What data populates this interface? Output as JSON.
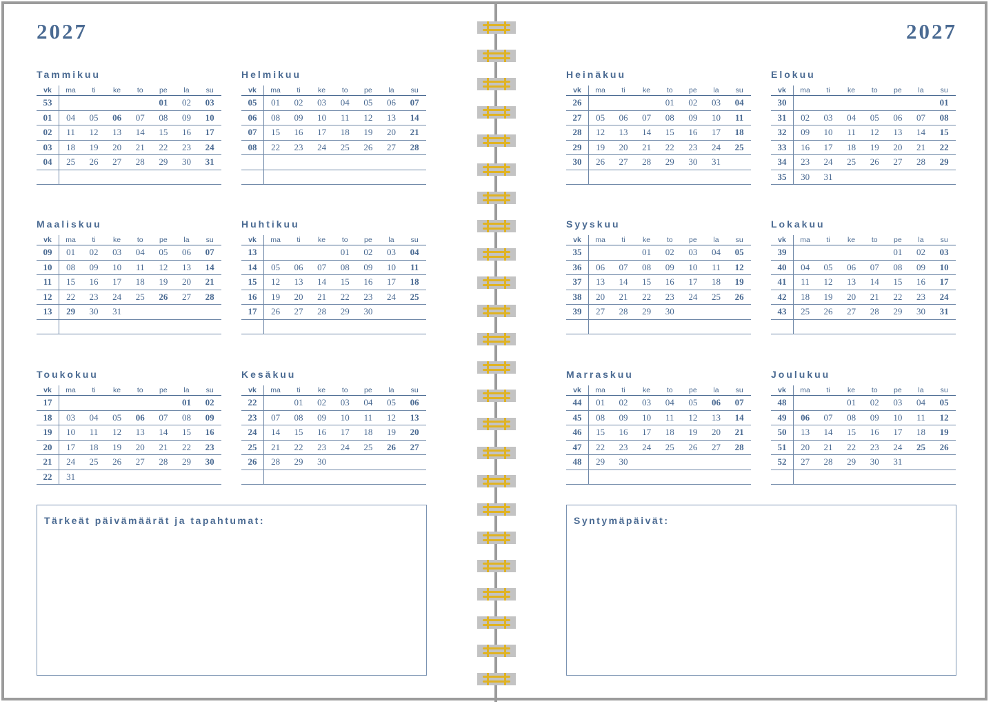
{
  "left_page": {
    "year": "2027"
  },
  "right_page": {
    "year": "2027"
  },
  "calendar": {
    "headers": [
      "vk",
      "ma",
      "ti",
      "ke",
      "to",
      "pe",
      "la",
      "su"
    ],
    "months": [
      {
        "name": "Tammikuu",
        "rows": [
          [
            "53",
            "",
            "",
            "",
            "",
            "01",
            "02",
            "03"
          ],
          [
            "01",
            "04",
            "05",
            "06",
            "07",
            "08",
            "09",
            "10"
          ],
          [
            "02",
            "11",
            "12",
            "13",
            "14",
            "15",
            "16",
            "17"
          ],
          [
            "03",
            "18",
            "19",
            "20",
            "21",
            "22",
            "23",
            "24"
          ],
          [
            "04",
            "25",
            "26",
            "27",
            "28",
            "29",
            "30",
            "31"
          ],
          [
            "",
            "",
            "",
            "",
            "",
            "",
            "",
            ""
          ]
        ],
        "holidays": [
          "01",
          "06"
        ]
      },
      {
        "name": "Helmikuu",
        "rows": [
          [
            "05",
            "01",
            "02",
            "03",
            "04",
            "05",
            "06",
            "07"
          ],
          [
            "06",
            "08",
            "09",
            "10",
            "11",
            "12",
            "13",
            "14"
          ],
          [
            "07",
            "15",
            "16",
            "17",
            "18",
            "19",
            "20",
            "21"
          ],
          [
            "08",
            "22",
            "23",
            "24",
            "25",
            "26",
            "27",
            "28"
          ],
          [
            "",
            "",
            "",
            "",
            "",
            "",
            "",
            ""
          ],
          [
            "",
            "",
            "",
            "",
            "",
            "",
            "",
            ""
          ]
        ],
        "holidays": []
      },
      {
        "name": "Maaliskuu",
        "rows": [
          [
            "09",
            "01",
            "02",
            "03",
            "04",
            "05",
            "06",
            "07"
          ],
          [
            "10",
            "08",
            "09",
            "10",
            "11",
            "12",
            "13",
            "14"
          ],
          [
            "11",
            "15",
            "16",
            "17",
            "18",
            "19",
            "20",
            "21"
          ],
          [
            "12",
            "22",
            "23",
            "24",
            "25",
            "26",
            "27",
            "28"
          ],
          [
            "13",
            "29",
            "30",
            "31",
            "",
            "",
            "",
            ""
          ],
          [
            "",
            "",
            "",
            "",
            "",
            "",
            "",
            ""
          ]
        ],
        "holidays": [
          "26",
          "29"
        ]
      },
      {
        "name": "Huhtikuu",
        "rows": [
          [
            "13",
            "",
            "",
            "",
            "01",
            "02",
            "03",
            "04"
          ],
          [
            "14",
            "05",
            "06",
            "07",
            "08",
            "09",
            "10",
            "11"
          ],
          [
            "15",
            "12",
            "13",
            "14",
            "15",
            "16",
            "17",
            "18"
          ],
          [
            "16",
            "19",
            "20",
            "21",
            "22",
            "23",
            "24",
            "25"
          ],
          [
            "17",
            "26",
            "27",
            "28",
            "29",
            "30",
            "",
            ""
          ],
          [
            "",
            "",
            "",
            "",
            "",
            "",
            "",
            ""
          ]
        ],
        "holidays": []
      },
      {
        "name": "Toukokuu",
        "rows": [
          [
            "17",
            "",
            "",
            "",
            "",
            "",
            "01",
            "02"
          ],
          [
            "18",
            "03",
            "04",
            "05",
            "06",
            "07",
            "08",
            "09"
          ],
          [
            "19",
            "10",
            "11",
            "12",
            "13",
            "14",
            "15",
            "16"
          ],
          [
            "20",
            "17",
            "18",
            "19",
            "20",
            "21",
            "22",
            "23"
          ],
          [
            "21",
            "24",
            "25",
            "26",
            "27",
            "28",
            "29",
            "30"
          ],
          [
            "22",
            "31",
            "",
            "",
            "",
            "",
            "",
            ""
          ]
        ],
        "holidays": [
          "01",
          "06"
        ]
      },
      {
        "name": "Kesäkuu",
        "rows": [
          [
            "22",
            "",
            "01",
            "02",
            "03",
            "04",
            "05",
            "06"
          ],
          [
            "23",
            "07",
            "08",
            "09",
            "10",
            "11",
            "12",
            "13"
          ],
          [
            "24",
            "14",
            "15",
            "16",
            "17",
            "18",
            "19",
            "20"
          ],
          [
            "25",
            "21",
            "22",
            "23",
            "24",
            "25",
            "26",
            "27"
          ],
          [
            "26",
            "28",
            "29",
            "30",
            "",
            "",
            "",
            ""
          ],
          [
            "",
            "",
            "",
            "",
            "",
            "",
            "",
            ""
          ]
        ],
        "holidays": [
          "26"
        ]
      },
      {
        "name": "Heinäkuu",
        "rows": [
          [
            "26",
            "",
            "",
            "",
            "01",
            "02",
            "03",
            "04"
          ],
          [
            "27",
            "05",
            "06",
            "07",
            "08",
            "09",
            "10",
            "11"
          ],
          [
            "28",
            "12",
            "13",
            "14",
            "15",
            "16",
            "17",
            "18"
          ],
          [
            "29",
            "19",
            "20",
            "21",
            "22",
            "23",
            "24",
            "25"
          ],
          [
            "30",
            "26",
            "27",
            "28",
            "29",
            "30",
            "31",
            ""
          ],
          [
            "",
            "",
            "",
            "",
            "",
            "",
            "",
            ""
          ]
        ],
        "holidays": []
      },
      {
        "name": "Elokuu",
        "rows": [
          [
            "30",
            "",
            "",
            "",
            "",
            "",
            "",
            "01"
          ],
          [
            "31",
            "02",
            "03",
            "04",
            "05",
            "06",
            "07",
            "08"
          ],
          [
            "32",
            "09",
            "10",
            "11",
            "12",
            "13",
            "14",
            "15"
          ],
          [
            "33",
            "16",
            "17",
            "18",
            "19",
            "20",
            "21",
            "22"
          ],
          [
            "34",
            "23",
            "24",
            "25",
            "26",
            "27",
            "28",
            "29"
          ],
          [
            "35",
            "30",
            "31",
            "",
            "",
            "",
            "",
            ""
          ]
        ],
        "holidays": []
      },
      {
        "name": "Syyskuu",
        "rows": [
          [
            "35",
            "",
            "",
            "01",
            "02",
            "03",
            "04",
            "05"
          ],
          [
            "36",
            "06",
            "07",
            "08",
            "09",
            "10",
            "11",
            "12"
          ],
          [
            "37",
            "13",
            "14",
            "15",
            "16",
            "17",
            "18",
            "19"
          ],
          [
            "38",
            "20",
            "21",
            "22",
            "23",
            "24",
            "25",
            "26"
          ],
          [
            "39",
            "27",
            "28",
            "29",
            "30",
            "",
            "",
            ""
          ],
          [
            "",
            "",
            "",
            "",
            "",
            "",
            "",
            ""
          ]
        ],
        "holidays": []
      },
      {
        "name": "Lokakuu",
        "rows": [
          [
            "39",
            "",
            "",
            "",
            "",
            "01",
            "02",
            "03"
          ],
          [
            "40",
            "04",
            "05",
            "06",
            "07",
            "08",
            "09",
            "10"
          ],
          [
            "41",
            "11",
            "12",
            "13",
            "14",
            "15",
            "16",
            "17"
          ],
          [
            "42",
            "18",
            "19",
            "20",
            "21",
            "22",
            "23",
            "24"
          ],
          [
            "43",
            "25",
            "26",
            "27",
            "28",
            "29",
            "30",
            "31"
          ],
          [
            "",
            "",
            "",
            "",
            "",
            "",
            "",
            ""
          ]
        ],
        "holidays": []
      },
      {
        "name": "Marraskuu",
        "rows": [
          [
            "44",
            "01",
            "02",
            "03",
            "04",
            "05",
            "06",
            "07"
          ],
          [
            "45",
            "08",
            "09",
            "10",
            "11",
            "12",
            "13",
            "14"
          ],
          [
            "46",
            "15",
            "16",
            "17",
            "18",
            "19",
            "20",
            "21"
          ],
          [
            "47",
            "22",
            "23",
            "24",
            "25",
            "26",
            "27",
            "28"
          ],
          [
            "48",
            "29",
            "30",
            "",
            "",
            "",
            "",
            ""
          ],
          [
            "",
            "",
            "",
            "",
            "",
            "",
            "",
            ""
          ]
        ],
        "holidays": [
          "06"
        ]
      },
      {
        "name": "Joulukuu",
        "rows": [
          [
            "48",
            "",
            "",
            "01",
            "02",
            "03",
            "04",
            "05"
          ],
          [
            "49",
            "06",
            "07",
            "08",
            "09",
            "10",
            "11",
            "12"
          ],
          [
            "50",
            "13",
            "14",
            "15",
            "16",
            "17",
            "18",
            "19"
          ],
          [
            "51",
            "20",
            "21",
            "22",
            "23",
            "24",
            "25",
            "26"
          ],
          [
            "52",
            "27",
            "28",
            "29",
            "30",
            "31",
            "",
            ""
          ],
          [
            "",
            "",
            "",
            "",
            "",
            "",
            "",
            ""
          ]
        ],
        "holidays": [
          "06",
          "25"
        ]
      }
    ]
  },
  "notes": {
    "important_dates": "Tärkeät päivämäärät ja tapahtumat:",
    "birthdays": "Syntymäpäivät:"
  },
  "colors": {
    "accent": "#4a6a92",
    "binding_wire": "#e0b323",
    "binding_plate": "#c3c3c3",
    "border": "#9b9b9b"
  },
  "binding": {
    "ring_count": 24
  }
}
